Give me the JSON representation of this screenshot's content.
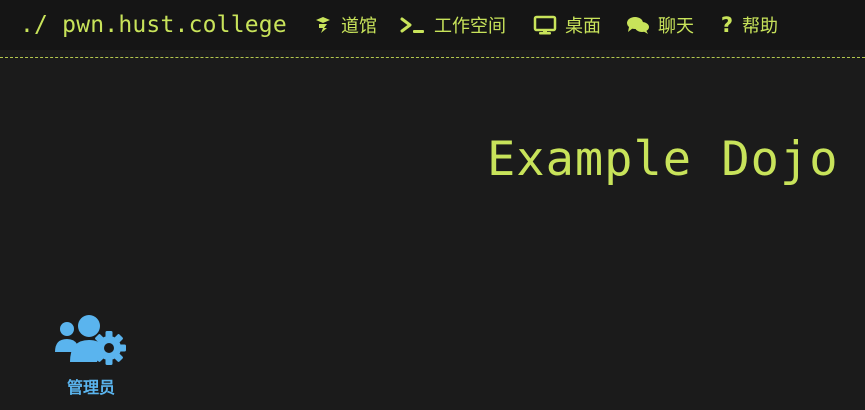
{
  "navbar": {
    "brand": "./ pwn.hust.college",
    "items": [
      {
        "label": "道馆",
        "icon": "dojo-icon"
      },
      {
        "label": "工作空间",
        "icon": "terminal-icon"
      },
      {
        "label": "桌面",
        "icon": "desktop-icon"
      },
      {
        "label": "聊天",
        "icon": "chat-icon"
      },
      {
        "label": "帮助",
        "icon": "help-icon"
      }
    ]
  },
  "main": {
    "title": "Example Dojo",
    "admin": {
      "label": "管理员",
      "icon": "users-cog-icon"
    }
  },
  "colors": {
    "accent": "#c8e35a",
    "admin": "#5ab4ee",
    "background": "#1b1b1b"
  }
}
